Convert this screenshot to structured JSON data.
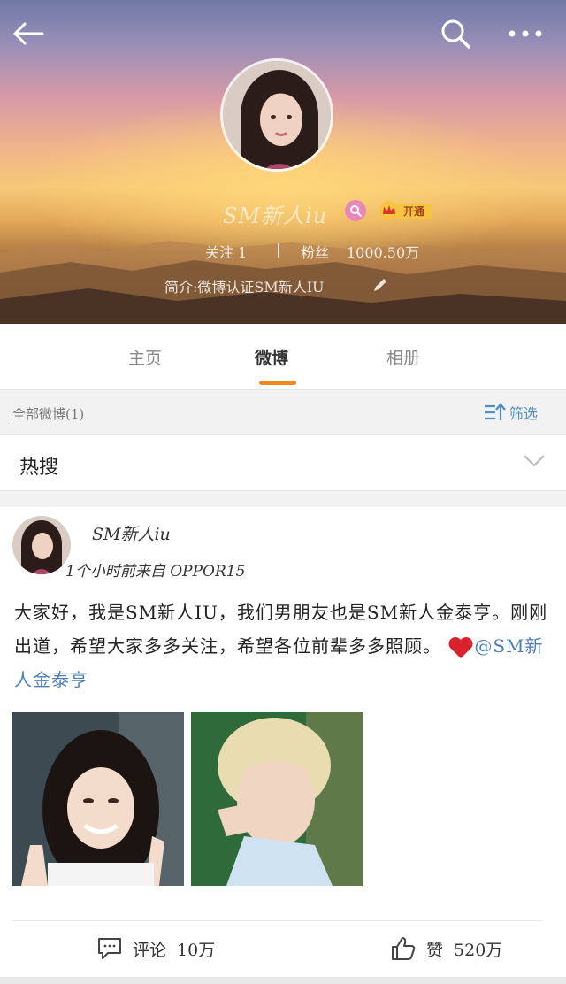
{
  "header": {
    "back_icon": "arrow-left-icon",
    "search_icon": "search-icon",
    "more_icon": "more-dots-icon",
    "name": "SM新人iu",
    "vip_label": "开通",
    "follow_label": "关注 1",
    "separator": "|",
    "fans_label": "粉丝",
    "fans_value": "1000.50万",
    "bio": "简介:微博认证SM新人IU"
  },
  "tabs": [
    {
      "label": "主页",
      "active": false
    },
    {
      "label": "微博",
      "active": true
    },
    {
      "label": "相册",
      "active": false
    }
  ],
  "filter": {
    "label": "全部微博(1)",
    "button_label": "筛选",
    "accent": "#4f8fc8"
  },
  "hot": {
    "title": "热搜"
  },
  "post": {
    "author": "SM新人iu",
    "meta": "1个小时前来自 OPPOR15",
    "text": "大家好，我是SM新人IU，我们男朋友也是SM新人金泰亨。刚刚出道，希望大家多多关注，希望各位前辈多多照顾。",
    "mention": "@SM新人金泰亨",
    "comment_label": "评论",
    "comment_count": "10万",
    "like_label": "赞",
    "like_count": "520万"
  },
  "colors": {
    "tab_underline": "#f08a1c",
    "mention": "#4a7fb6"
  }
}
